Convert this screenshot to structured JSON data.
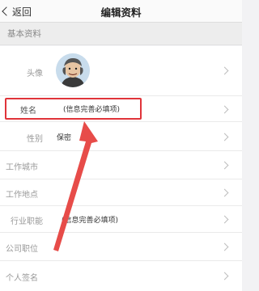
{
  "header": {
    "back_label": "返回",
    "title": "编辑资料"
  },
  "section": {
    "title": "基本资料"
  },
  "rows": [
    {
      "label": "头像",
      "value": ""
    },
    {
      "label": "姓名",
      "value": "(信息完善必填项)"
    },
    {
      "label": "性别",
      "value": "保密"
    },
    {
      "label": "工作城市",
      "value": ""
    },
    {
      "label": "工作地点",
      "value": ""
    },
    {
      "label": "行业职能",
      "value": "(信息完善必填项)"
    },
    {
      "label": "公司职位",
      "value": ""
    },
    {
      "label": "个人签名",
      "value": ""
    }
  ],
  "colors": {
    "highlight": "#e0343a",
    "pointer_arrow": "#e74c49"
  },
  "icons": {
    "back": "chevron-left-icon",
    "row_arrow": "chevron-right-icon",
    "avatar": "user-avatar-illustration"
  }
}
